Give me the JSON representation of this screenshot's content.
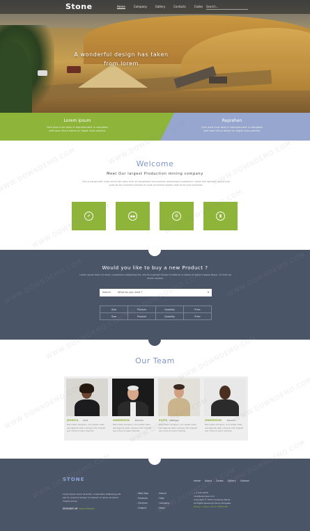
{
  "nav": {
    "brand": "Stone",
    "menu": [
      "Home",
      "Company",
      "Gallery",
      "Contacts",
      "Codes"
    ],
    "search_placeholder": "Search..."
  },
  "hero": {
    "headline": "A wonderful design has taken from lorem"
  },
  "features": [
    {
      "title": "Lorem ipsum",
      "text": "Duis aute irure dolor in reprehenderit in voluptate velit esse cillum dolore eu fugiat nulla pariatur."
    },
    {
      "title": "Reprehen",
      "text": "Duis aute irure dolor in reprehenderit in voluptate velit esse cillum dolore eu fugiat nulla pariatur."
    }
  ],
  "welcome": {
    "title": "Welcome",
    "subtitle": "Meet Our largest Production mining company",
    "text": "Sed ut perspiciatis unde omnis iste natus error sit voluptatem accusantium doloremque laudantium, totam rem aperiam, eaque ipsa quae ab illo inventore veritatis et quasi architecto beatae vitae dicta sunt explicabo.",
    "tiles": [
      {
        "icon": "check-icon",
        "glyph": "✔"
      },
      {
        "icon": "users-icon",
        "glyph": "●●"
      },
      {
        "icon": "cogs-icon",
        "glyph": "⚙"
      },
      {
        "icon": "bar-chart-icon",
        "glyph": "▮"
      }
    ]
  },
  "product": {
    "title": "Would you like to buy a new Product ?",
    "text": "Lorem ipsum dolor sit amet, consectetur adipiscing elit, sed do eiusmod tempor incididunt ut labore et dolore magna aliqua. Ut enim ad minim veniam.",
    "select_label": "Search",
    "select_value": "What do you need ?",
    "table": [
      [
        "Size",
        "Product",
        "Quantity",
        "Price"
      ],
      [
        "Size",
        "Product",
        "Quantity",
        "Price"
      ]
    ]
  },
  "team": {
    "title": "Our Team",
    "members": [
      {
        "name": "JESSICA",
        "role": "Chef",
        "desc": "Nam libero tempore, cum soluta nobis est eligendi optio cumque nihil impedit quo minus id quod maxime."
      },
      {
        "name": "ANDERSON",
        "role": "Director",
        "desc": "Nam libero tempore, cum soluta nobis est eligendi optio cumque nihil impedit quo minus id quod maxime."
      },
      {
        "name": "ELIPS",
        "role": "Manager",
        "desc": "Nam libero tempore, cum soluta nobis est eligendi optio cumque nihil impedit quo minus id quod maxime."
      },
      {
        "name": "ANDERSON",
        "role": "Director",
        "desc": "Nam libero tempore, cum soluta nobis est eligendi optio cumque nihil impedit quo minus id quod maxime."
      }
    ]
  },
  "footer": {
    "brand": "STONE",
    "about": "Lorem ipsum dolor sit amet, consectetur adipiscing elit, sed do eiusmod tempor incididunt ut labore et dolore magna aliqua.",
    "by_label": "DESIGNED BY",
    "by_name": "Lorem Mahem",
    "menu": [
      "Home",
      "About",
      "Codes",
      "Gallery",
      "Contact"
    ],
    "col1": [
      "Web Map",
      "Products",
      "Services",
      "Subject"
    ],
    "col2": [
      "Search",
      "Help",
      "Company",
      "News"
    ],
    "contact": [
      "+ 1 234 5678",
      "mail@example.com",
      "Copyright © 2016 Company Name",
      "All Rights Reserved Stone Template"
    ],
    "contact_highlight": "Design : Dalton Stone TEMPLATE"
  },
  "watermark": "WWW.DOWNDEMO.COM",
  "colors": {
    "accent_green": "#8eb43a",
    "accent_blue": "#7f95c7",
    "dark_slate": "#4b5568"
  }
}
